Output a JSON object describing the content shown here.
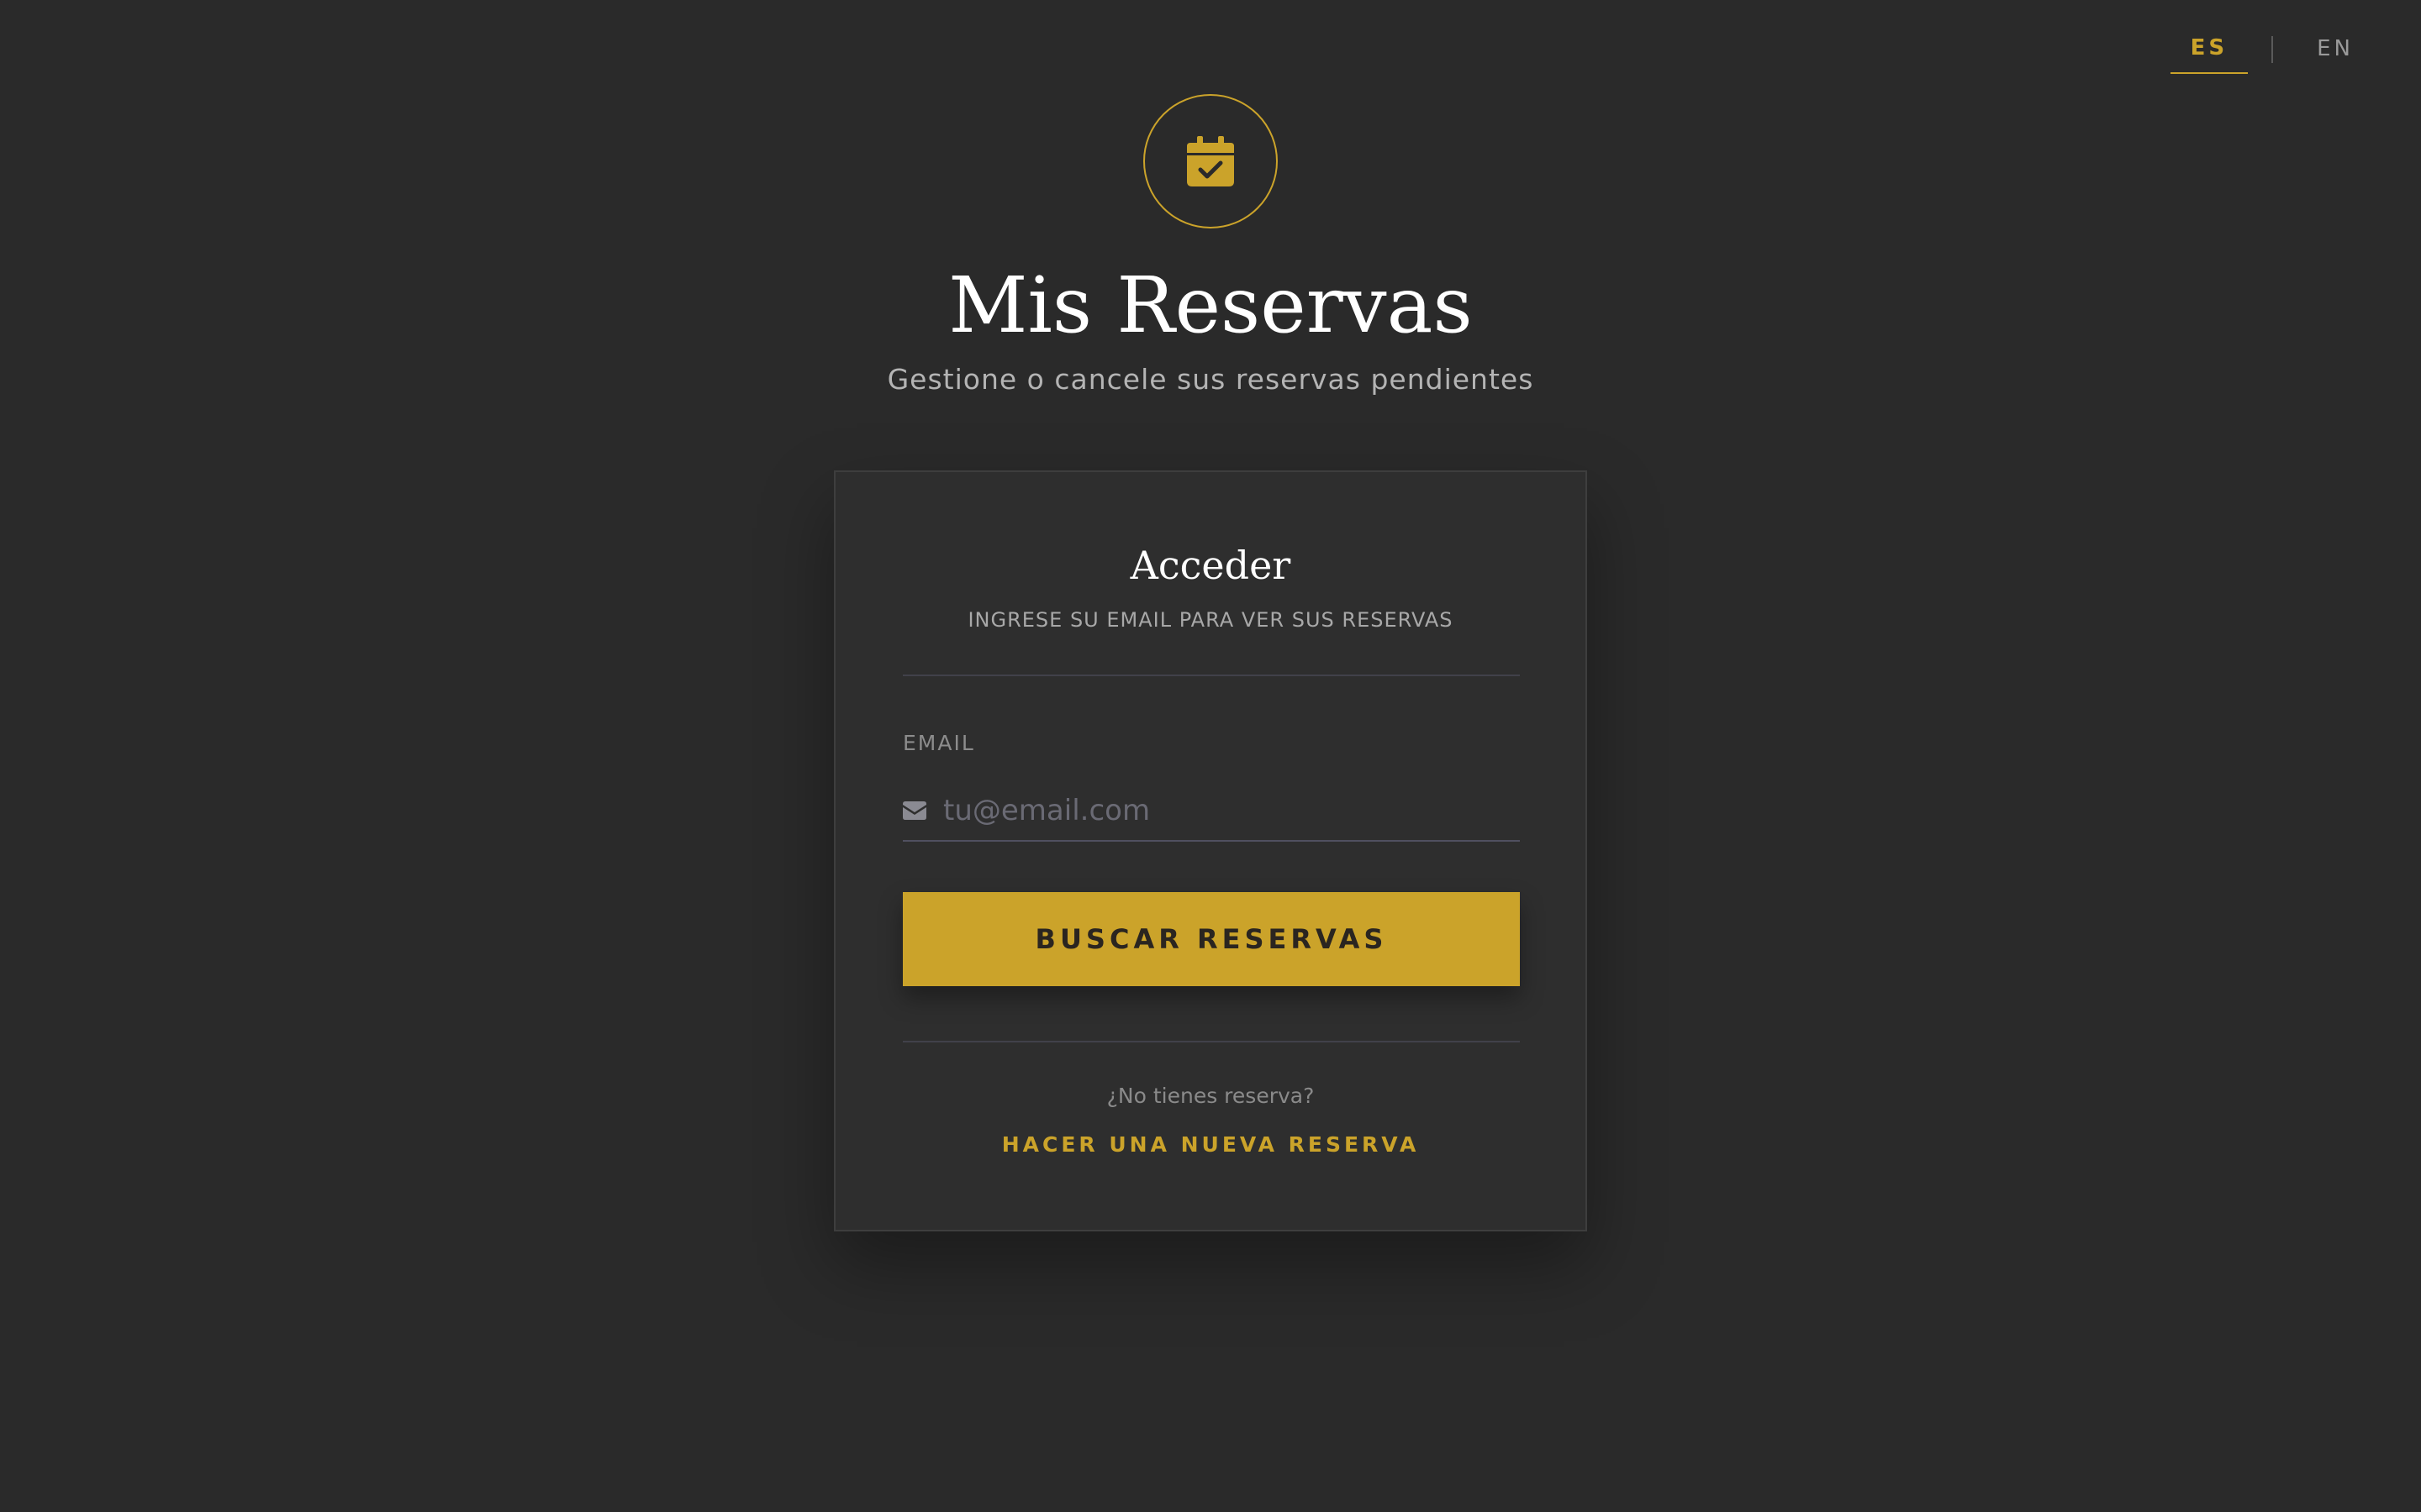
{
  "language": {
    "active": "ES",
    "other": "EN"
  },
  "header": {
    "icon": "calendar-check-icon",
    "title": "Mis Reservas",
    "subtitle": "Gestione o cancele sus reservas pendientes"
  },
  "login": {
    "title": "Acceder",
    "subtitle": "INGRESE SU EMAIL PARA VER SUS RESERVAS",
    "email_label": "EMAIL",
    "email_icon": "envelope-icon",
    "email_placeholder": "tu@email.com",
    "email_value": "",
    "submit_label": "BUSCAR RESERVAS",
    "no_reservation_text": "¿No tienes reserva?",
    "new_reservation_link": "HACER UNA NUEVA RESERVA"
  },
  "colors": {
    "background": "#2a2a2a",
    "card": "#2e2e2e",
    "accent": "#cba32a"
  }
}
